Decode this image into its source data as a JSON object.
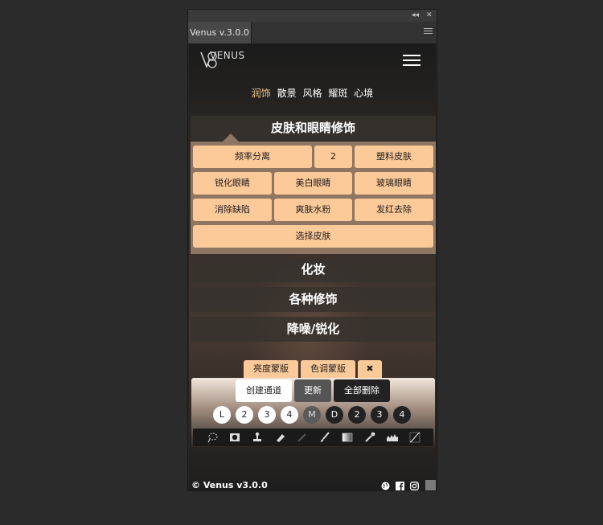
{
  "panel": {
    "collapse_glyph": "◂◂",
    "close_glyph": "✕",
    "tab_title": "Venus v.3.0.0"
  },
  "brand": {
    "logo_text": "VENUS"
  },
  "nav": [
    "润饰",
    "散景",
    "风格",
    "耀斑",
    "心境"
  ],
  "sections": {
    "skin_eyes": {
      "title": "皮肤和眼睛修饰",
      "buttons": [
        "频率分离",
        "2",
        "塑料皮肤",
        "锐化眼睛",
        "美白眼睛",
        "玻璃眼睛",
        "消除缺陷",
        "爽肤水粉",
        "发红去除",
        "选择皮肤"
      ]
    },
    "makeup": "化妆",
    "misc": "各种修饰",
    "denoise": "降噪/锐化"
  },
  "masks": {
    "tabs": [
      "亮度蒙版",
      "色调蒙版"
    ],
    "close": "✖",
    "create_channel": "创建通道",
    "update": "更新",
    "delete_all": "全部删除",
    "levels": [
      "L",
      "2",
      "3",
      "4",
      "M",
      "D",
      "2",
      "3",
      "4"
    ]
  },
  "tools": [
    "lasso-icon",
    "mask-icon",
    "stamp-icon",
    "eraser-icon",
    "pen-icon",
    "brush-icon",
    "gradient-icon",
    "eyedropper-icon",
    "histogram-icon",
    "curves-icon"
  ],
  "footer": {
    "copyright": "© Venus v3.0.0"
  },
  "colors": {
    "accent": "#f2c48c",
    "button": "#fcc998"
  }
}
